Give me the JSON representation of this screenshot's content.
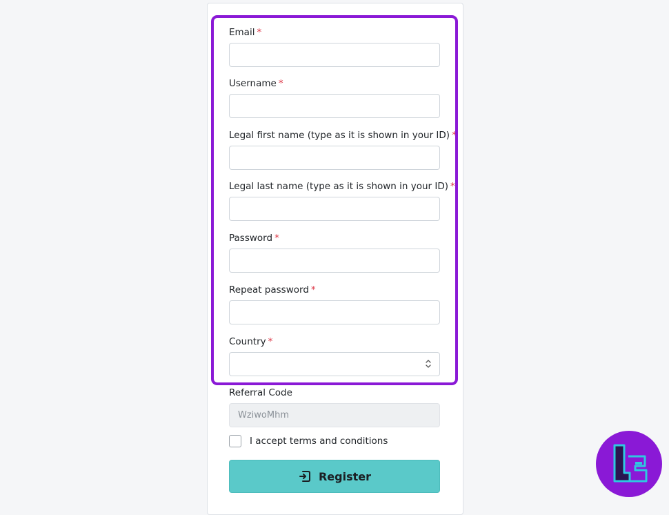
{
  "form": {
    "email": {
      "label": "Email",
      "required": "*",
      "value": ""
    },
    "username": {
      "label": "Username",
      "required": "*",
      "value": ""
    },
    "first_name": {
      "label": "Legal first name (type as it is shown in your ID)",
      "required": "*",
      "value": ""
    },
    "last_name": {
      "label": "Legal last name (type as it is shown in your ID)",
      "required": "*",
      "value": ""
    },
    "password": {
      "label": "Password",
      "required": "*",
      "value": ""
    },
    "repeat_password": {
      "label": "Repeat password",
      "required": "*",
      "value": ""
    },
    "country": {
      "label": "Country",
      "required": "*",
      "selected": ""
    },
    "referral": {
      "label": "Referral Code",
      "value": "WziwoMhm"
    },
    "terms_label": "I accept terms and conditions",
    "terms_checked": false,
    "register_label": "Register"
  },
  "colors": {
    "highlight": "#8a19d6",
    "button": "#5ac9c9",
    "required": "#dc3545",
    "logo_bg": "#8a19d6",
    "logo_fg": "#2ec8e0"
  },
  "icons": {
    "register": "sign-in-icon",
    "country_select": "chevron-up-down-icon",
    "watermark": "brand-logo"
  }
}
